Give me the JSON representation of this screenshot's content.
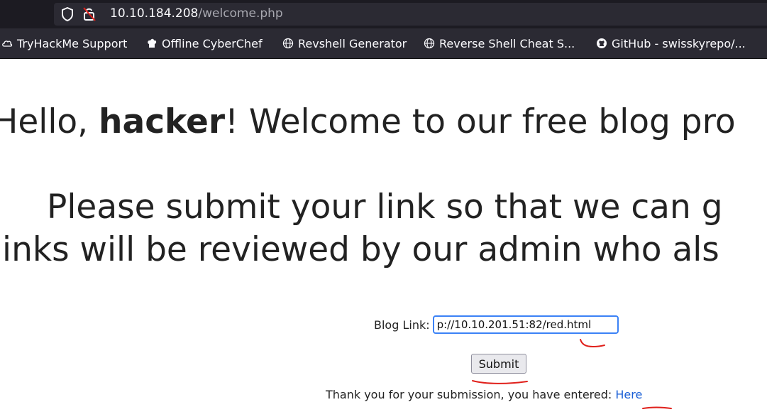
{
  "browser": {
    "url_host": "10.10.184.208",
    "url_path": "/welcome.php",
    "bookmarks": [
      {
        "label": "TryHackMe Support",
        "icon": "cloud-icon"
      },
      {
        "label": "Offline CyberChef",
        "icon": "chef-hat-icon"
      },
      {
        "label": "Revshell Generator",
        "icon": "globe-icon"
      },
      {
        "label": "Reverse Shell Cheat S...",
        "icon": "globe-icon"
      },
      {
        "label": "GitHub - swisskyrepo/...",
        "icon": "github-icon"
      }
    ]
  },
  "page": {
    "greeting_prefix": "Hello, ",
    "greeting_name": "hacker",
    "greeting_suffix": "! Welcome to our free blog pro",
    "instruction_line1": "Please submit your link so that we can g",
    "instruction_line2": "links will be reviewed by our admin who als",
    "form": {
      "label": "Blog Link:",
      "value": "p://10.10.201.51:82/red.html",
      "submit_label": "Submit"
    },
    "thanks_text": "Thank you for your submission, you have entered: ",
    "thanks_link": "Here"
  },
  "colors": {
    "chrome_bg": "#1c1b22",
    "toolbar_bg": "#2b2a33",
    "link": "#1a5fd6",
    "annotation": "#e0201b",
    "input_focus": "#3b82f6"
  }
}
